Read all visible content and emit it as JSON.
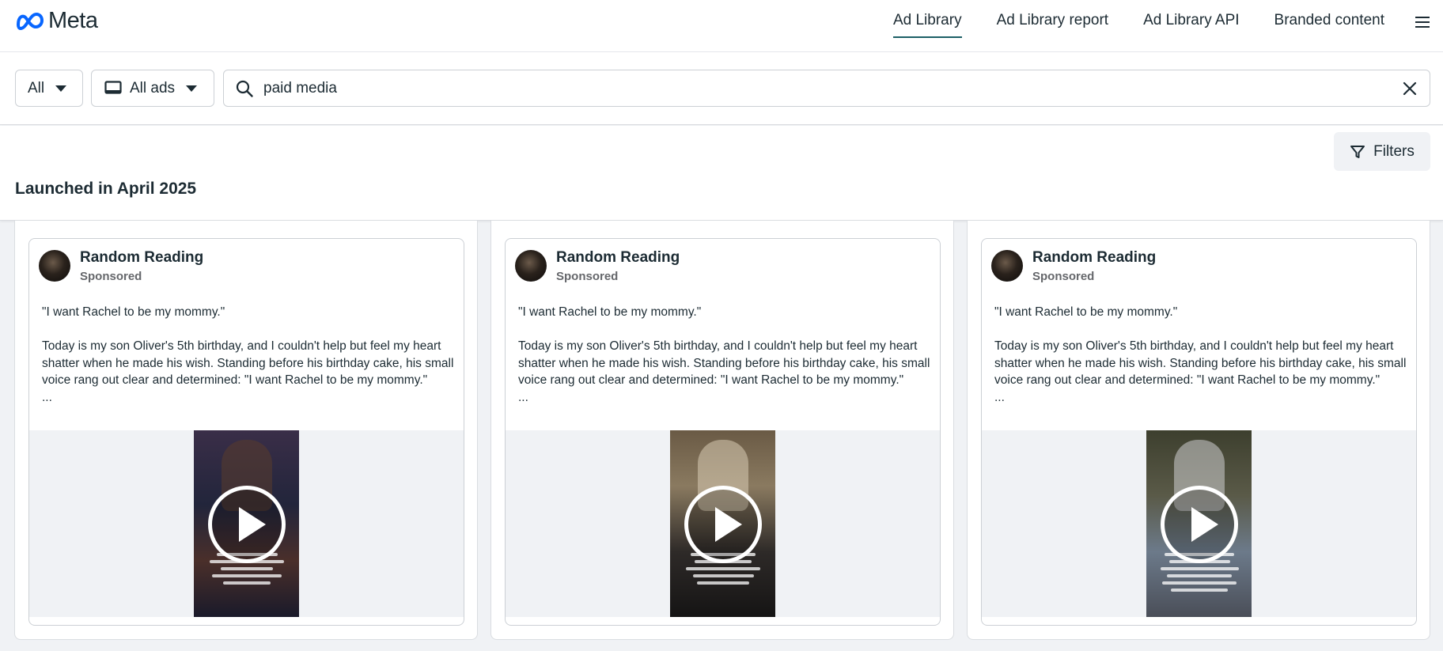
{
  "brand": {
    "name": "Meta",
    "accent": "#0866ff"
  },
  "nav": {
    "items": [
      {
        "label": "Ad Library",
        "active": true
      },
      {
        "label": "Ad Library report",
        "active": false
      },
      {
        "label": "Ad Library API",
        "active": false
      },
      {
        "label": "Branded content",
        "active": false
      }
    ],
    "menu_icon": "hamburger-icon"
  },
  "search": {
    "country_dropdown": "All",
    "ad_type_dropdown": "All ads",
    "query": "paid media",
    "search_icon": "search-icon",
    "clear_icon": "close-icon"
  },
  "results": {
    "filters_label": "Filters",
    "launched_label": "Launched in April 2025"
  },
  "ads": [
    {
      "advertiser": "Random Reading",
      "sponsored": "Sponsored",
      "quote": "\"I want Rachel to be my mommy.\"",
      "body": "Today is my son Oliver's 5th birthday, and I couldn't help but feel my heart shatter when he made his wish. Standing before his birthday cake, his small voice rang out clear and determined: \"I want Rachel to be my mommy.\"",
      "ellipsis": "..."
    },
    {
      "advertiser": "Random Reading",
      "sponsored": "Sponsored",
      "quote": "\"I want Rachel to be my mommy.\"",
      "body": "Today is my son Oliver's 5th birthday, and I couldn't help but feel my heart shatter when he made his wish. Standing before his birthday cake, his small voice rang out clear and determined: \"I want Rachel to be my mommy.\"",
      "ellipsis": "..."
    },
    {
      "advertiser": "Random Reading",
      "sponsored": "Sponsored",
      "quote": "\"I want Rachel to be my mommy.\"",
      "body": "Today is my son Oliver's 5th birthday, and I couldn't help but feel my heart shatter when he made his wish. Standing before his birthday cake, his small voice rang out clear and determined: \"I want Rachel to be my mommy.\"",
      "ellipsis": "..."
    }
  ]
}
